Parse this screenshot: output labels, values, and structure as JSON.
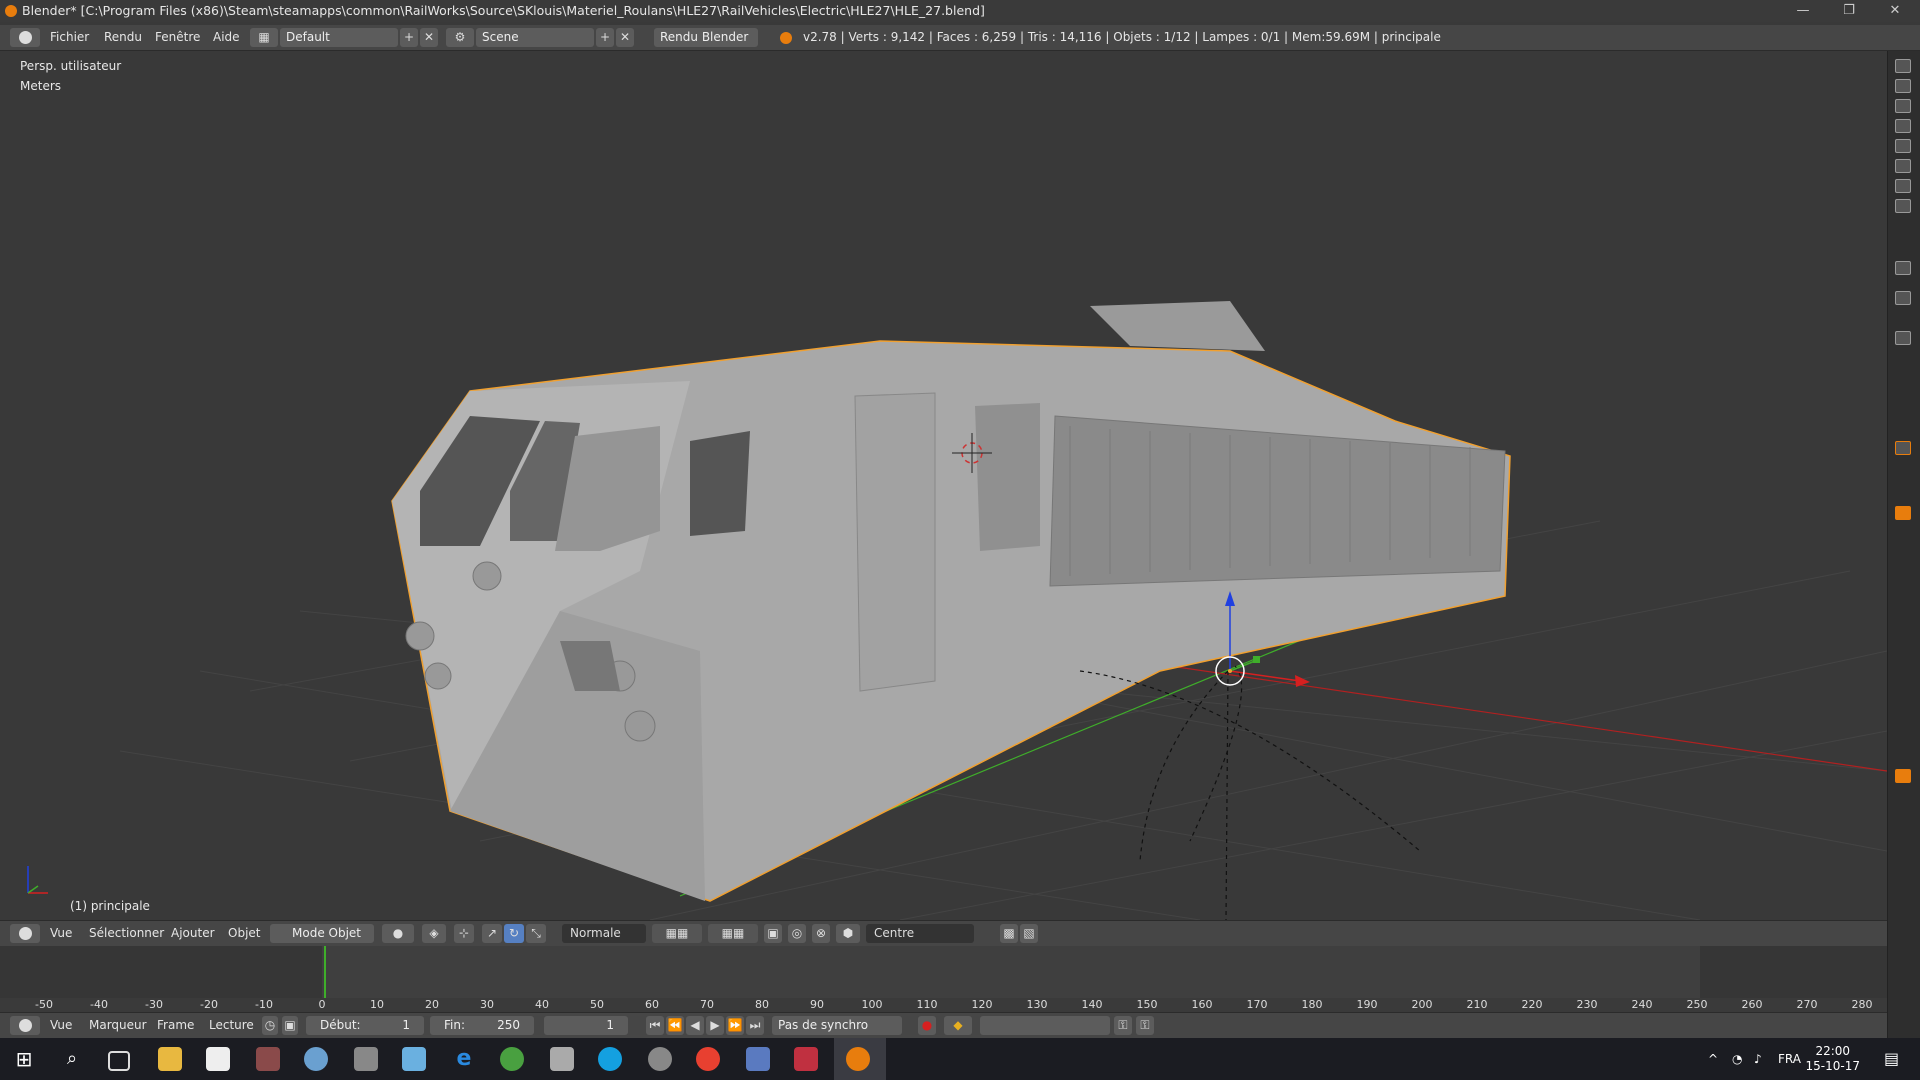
{
  "titlebar": {
    "title": "Blender* [C:\\Program Files (x86)\\Steam\\steamapps\\common\\RailWorks\\Source\\SKlouis\\Materiel_Roulans\\HLE27\\RailVehicles\\Electric\\HLE27\\HLE_27.blend]",
    "minimize": "—",
    "restore": "❐",
    "close": "✕"
  },
  "infobar": {
    "menus": [
      "Fichier",
      "Rendu",
      "Fenêtre",
      "Aide"
    ],
    "layout": "Default",
    "scene": "Scene",
    "engine": "Rendu Blender",
    "stats": "v2.78 | Verts : 9,142 | Faces : 6,259 | Tris : 14,116 | Objets : 1/12 | Lampes : 0/1 | Mem:59.69M | principale"
  },
  "viewport": {
    "view_name": "Persp. utilisateur",
    "units": "Meters",
    "object_label": "(1) principale"
  },
  "header3d": {
    "menus": [
      "Vue",
      "Sélectionner",
      "Ajouter",
      "Objet"
    ],
    "mode": "Mode Objet",
    "orientation": "Normale",
    "pivot": "Centre"
  },
  "timeline": {
    "ticks": [
      "-50",
      "-40",
      "-30",
      "-20",
      "-10",
      "0",
      "10",
      "20",
      "30",
      "40",
      "50",
      "60",
      "70",
      "80",
      "90",
      "100",
      "110",
      "120",
      "130",
      "140",
      "150",
      "160",
      "170",
      "180",
      "190",
      "200",
      "210",
      "220",
      "230",
      "240",
      "250",
      "260",
      "270",
      "280"
    ],
    "menus": [
      "Vue",
      "Marqueur",
      "Frame",
      "Lecture"
    ],
    "start_label": "Début:",
    "start_value": "1",
    "end_label": "Fin:",
    "end_value": "250",
    "current": "1",
    "sync": "Pas de synchro"
  },
  "taskbar": {
    "lang": "FRA",
    "time": "22:00",
    "date": "15-10-17"
  },
  "colors": {
    "blender_orange": "#e87d0d",
    "axis_x": "#d62020",
    "axis_y": "#3fae2a",
    "axis_z": "#2040e0"
  }
}
